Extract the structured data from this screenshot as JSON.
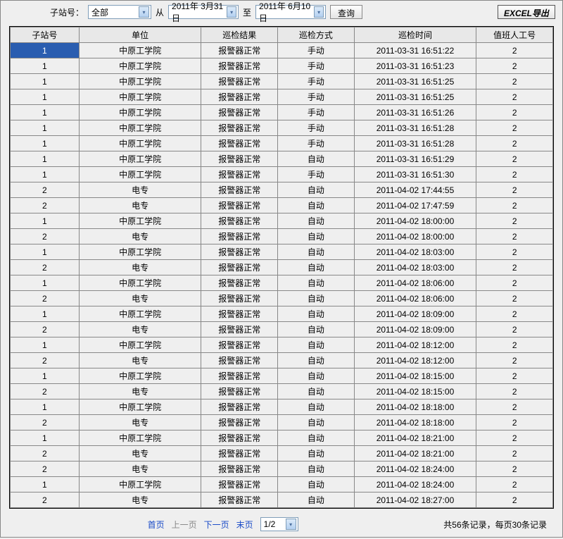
{
  "toolbar": {
    "station_label": "子站号：",
    "station_value": "全部",
    "from_label": "从",
    "from_date": "2011年 3月31日",
    "to_label": "至",
    "to_date": "2011年 6月10日",
    "query_label": "查询",
    "export_label": "EXCEL导出"
  },
  "columns": {
    "id": "子站号",
    "unit": "单位",
    "result": "巡检结果",
    "method": "巡检方式",
    "time": "巡检时间",
    "worker": "值班人工号"
  },
  "rows": [
    {
      "id": "1",
      "unit": "中原工学院",
      "result": "报警器正常",
      "method": "手动",
      "time": "2011-03-31 16:51:22",
      "worker": "2",
      "selected": true
    },
    {
      "id": "1",
      "unit": "中原工学院",
      "result": "报警器正常",
      "method": "手动",
      "time": "2011-03-31 16:51:23",
      "worker": "2"
    },
    {
      "id": "1",
      "unit": "中原工学院",
      "result": "报警器正常",
      "method": "手动",
      "time": "2011-03-31 16:51:25",
      "worker": "2"
    },
    {
      "id": "1",
      "unit": "中原工学院",
      "result": "报警器正常",
      "method": "手动",
      "time": "2011-03-31 16:51:25",
      "worker": "2"
    },
    {
      "id": "1",
      "unit": "中原工学院",
      "result": "报警器正常",
      "method": "手动",
      "time": "2011-03-31 16:51:26",
      "worker": "2"
    },
    {
      "id": "1",
      "unit": "中原工学院",
      "result": "报警器正常",
      "method": "手动",
      "time": "2011-03-31 16:51:28",
      "worker": "2"
    },
    {
      "id": "1",
      "unit": "中原工学院",
      "result": "报警器正常",
      "method": "手动",
      "time": "2011-03-31 16:51:28",
      "worker": "2"
    },
    {
      "id": "1",
      "unit": "中原工学院",
      "result": "报警器正常",
      "method": "自动",
      "time": "2011-03-31 16:51:29",
      "worker": "2"
    },
    {
      "id": "1",
      "unit": "中原工学院",
      "result": "报警器正常",
      "method": "手动",
      "time": "2011-03-31 16:51:30",
      "worker": "2"
    },
    {
      "id": "2",
      "unit": "电专",
      "result": "报警器正常",
      "method": "自动",
      "time": "2011-04-02 17:44:55",
      "worker": "2"
    },
    {
      "id": "2",
      "unit": "电专",
      "result": "报警器正常",
      "method": "自动",
      "time": "2011-04-02 17:47:59",
      "worker": "2"
    },
    {
      "id": "1",
      "unit": "中原工学院",
      "result": "报警器正常",
      "method": "自动",
      "time": "2011-04-02 18:00:00",
      "worker": "2"
    },
    {
      "id": "2",
      "unit": "电专",
      "result": "报警器正常",
      "method": "自动",
      "time": "2011-04-02 18:00:00",
      "worker": "2"
    },
    {
      "id": "1",
      "unit": "中原工学院",
      "result": "报警器正常",
      "method": "自动",
      "time": "2011-04-02 18:03:00",
      "worker": "2"
    },
    {
      "id": "2",
      "unit": "电专",
      "result": "报警器正常",
      "method": "自动",
      "time": "2011-04-02 18:03:00",
      "worker": "2"
    },
    {
      "id": "1",
      "unit": "中原工学院",
      "result": "报警器正常",
      "method": "自动",
      "time": "2011-04-02 18:06:00",
      "worker": "2"
    },
    {
      "id": "2",
      "unit": "电专",
      "result": "报警器正常",
      "method": "自动",
      "time": "2011-04-02 18:06:00",
      "worker": "2"
    },
    {
      "id": "1",
      "unit": "中原工学院",
      "result": "报警器正常",
      "method": "自动",
      "time": "2011-04-02 18:09:00",
      "worker": "2"
    },
    {
      "id": "2",
      "unit": "电专",
      "result": "报警器正常",
      "method": "自动",
      "time": "2011-04-02 18:09:00",
      "worker": "2"
    },
    {
      "id": "1",
      "unit": "中原工学院",
      "result": "报警器正常",
      "method": "自动",
      "time": "2011-04-02 18:12:00",
      "worker": "2"
    },
    {
      "id": "2",
      "unit": "电专",
      "result": "报警器正常",
      "method": "自动",
      "time": "2011-04-02 18:12:00",
      "worker": "2"
    },
    {
      "id": "1",
      "unit": "中原工学院",
      "result": "报警器正常",
      "method": "自动",
      "time": "2011-04-02 18:15:00",
      "worker": "2"
    },
    {
      "id": "2",
      "unit": "电专",
      "result": "报警器正常",
      "method": "自动",
      "time": "2011-04-02 18:15:00",
      "worker": "2"
    },
    {
      "id": "1",
      "unit": "中原工学院",
      "result": "报警器正常",
      "method": "自动",
      "time": "2011-04-02 18:18:00",
      "worker": "2"
    },
    {
      "id": "2",
      "unit": "电专",
      "result": "报警器正常",
      "method": "自动",
      "time": "2011-04-02 18:18:00",
      "worker": "2"
    },
    {
      "id": "1",
      "unit": "中原工学院",
      "result": "报警器正常",
      "method": "自动",
      "time": "2011-04-02 18:21:00",
      "worker": "2"
    },
    {
      "id": "2",
      "unit": "电专",
      "result": "报警器正常",
      "method": "自动",
      "time": "2011-04-02 18:21:00",
      "worker": "2"
    },
    {
      "id": "2",
      "unit": "电专",
      "result": "报警器正常",
      "method": "自动",
      "time": "2011-04-02 18:24:00",
      "worker": "2"
    },
    {
      "id": "1",
      "unit": "中原工学院",
      "result": "报警器正常",
      "method": "自动",
      "time": "2011-04-02 18:24:00",
      "worker": "2"
    },
    {
      "id": "2",
      "unit": "电专",
      "result": "报警器正常",
      "method": "自动",
      "time": "2011-04-02 18:27:00",
      "worker": "2"
    }
  ],
  "pager": {
    "first": "首页",
    "prev": "上一页",
    "next": "下一页",
    "last": "末页",
    "page_display": "1/2",
    "info": "共56条记录，每页30条记录"
  }
}
